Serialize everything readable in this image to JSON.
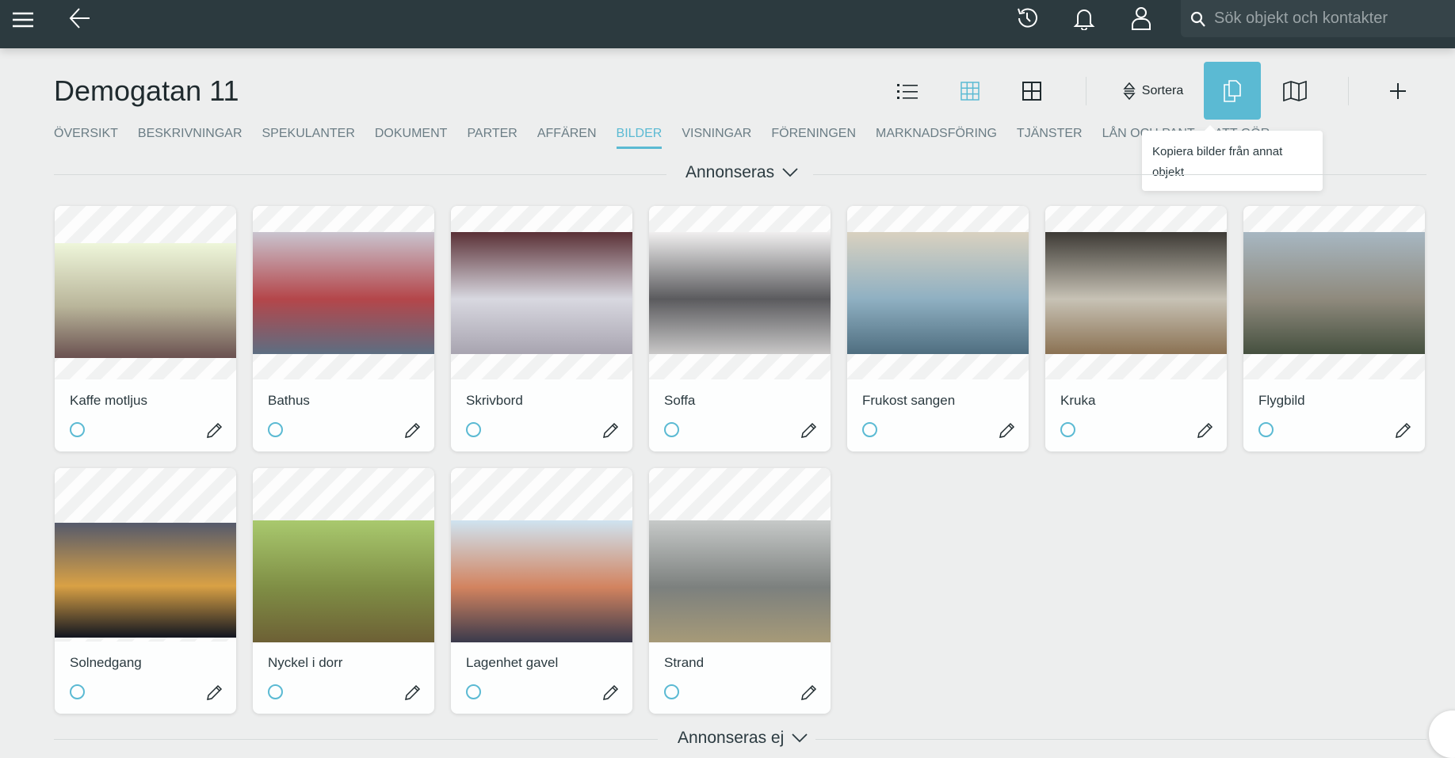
{
  "header": {
    "search_placeholder": "Sök objekt och kontakter",
    "icons": [
      "menu-icon",
      "back-arrow-icon",
      "history-icon",
      "bell-icon",
      "user-icon",
      "search-icon"
    ]
  },
  "page": {
    "title": "Demogatan 11"
  },
  "tabs": [
    {
      "label": "ÖVERSIKT"
    },
    {
      "label": "BESKRIVNINGAR"
    },
    {
      "label": "SPEKULANTER"
    },
    {
      "label": "DOKUMENT"
    },
    {
      "label": "PARTER"
    },
    {
      "label": "AFFÄREN"
    },
    {
      "label": "BILDER",
      "active": true
    },
    {
      "label": "VISNINGAR"
    },
    {
      "label": "FÖRENINGEN"
    },
    {
      "label": "MARKNADSFÖRING"
    },
    {
      "label": "TJÄNSTER"
    },
    {
      "label": "LÅN OCH PANT"
    },
    {
      "label": "ATT GÖR"
    }
  ],
  "toolbar": {
    "sort_label": "Sortera",
    "copy_tooltip": "Kopiera bilder från annat objekt",
    "accent": "#5bbad3"
  },
  "sections": {
    "advertised": "Annonseras",
    "not_advertised": "Annonseras ej"
  },
  "images": [
    {
      "label": "Kaffe motljus",
      "colors": [
        "#eef6da",
        "#b9b59a",
        "#6a5150"
      ]
    },
    {
      "label": "Bathus",
      "colors": [
        "#c9c4cf",
        "#b4464a",
        "#5d6e82"
      ]
    },
    {
      "label": "Skrivbord",
      "colors": [
        "#5a3036",
        "#d8d8e0",
        "#a8a4b0"
      ]
    },
    {
      "label": "Soffa",
      "colors": [
        "#f0efef",
        "#5b5b5e",
        "#c8c7c7"
      ]
    },
    {
      "label": "Frukost sangen",
      "colors": [
        "#d9d1c0",
        "#8fb0c2",
        "#4f6e80"
      ]
    },
    {
      "label": "Kruka",
      "colors": [
        "#3d3a35",
        "#c7c2b5",
        "#8b7253"
      ]
    },
    {
      "label": "Flygbild",
      "colors": [
        "#a7b7c2",
        "#8f8a7d",
        "#45503f"
      ]
    },
    {
      "label": "Solnedgang",
      "colors": [
        "#555a6c",
        "#d9a145",
        "#111520"
      ]
    },
    {
      "label": "Nyckel i dorr",
      "colors": [
        "#a9c96e",
        "#7f8e45",
        "#6d6035"
      ]
    },
    {
      "label": "Lagenhet gavel",
      "colors": [
        "#cfe3f0",
        "#d2835f",
        "#3a3a4c"
      ]
    },
    {
      "label": "Strand",
      "colors": [
        "#c6c9c8",
        "#7c807e",
        "#a69a78"
      ]
    }
  ]
}
